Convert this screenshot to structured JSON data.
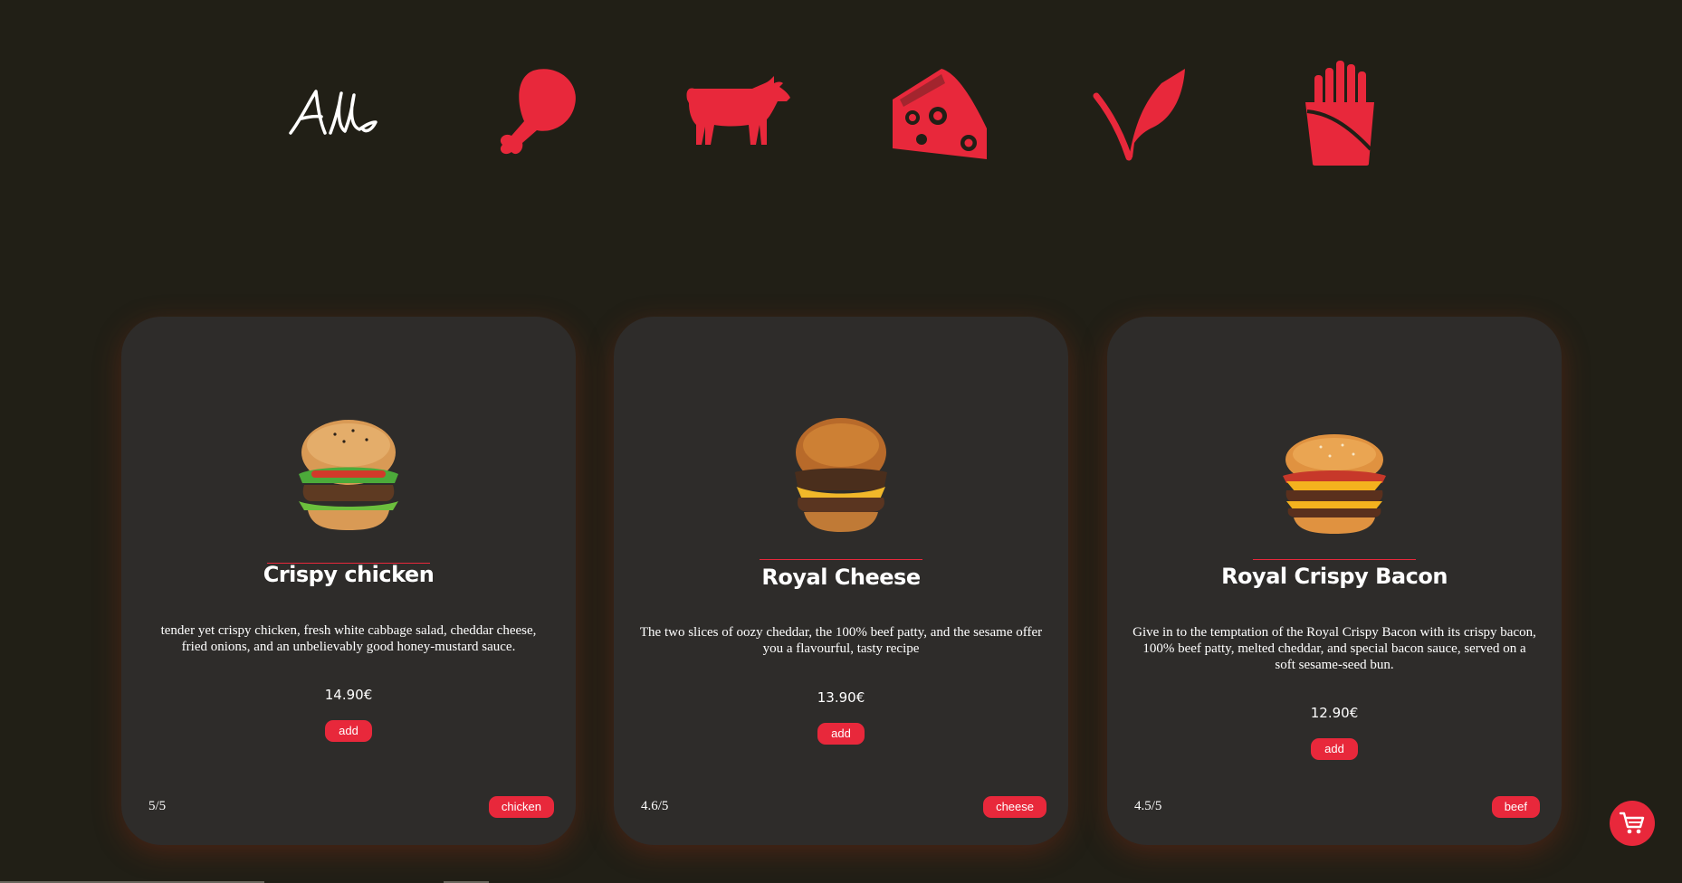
{
  "categories": [
    {
      "label": "All",
      "icon": "all-script-icon"
    },
    {
      "label": "chicken",
      "icon": "chicken-leg-icon"
    },
    {
      "label": "beef",
      "icon": "cow-icon"
    },
    {
      "label": "cheese",
      "icon": "cheese-icon"
    },
    {
      "label": "vegetarian",
      "icon": "leaf-icon"
    },
    {
      "label": "fries",
      "icon": "fries-icon"
    }
  ],
  "accent_color": "#e8283b",
  "background_color": "#211f16",
  "card_color": "#2e2c2a",
  "cards": [
    {
      "title": "Crispy chicken",
      "description": "tender yet crispy chicken, fresh white cabbage salad, cheddar cheese, fried onions, and an unbelievably good honey-mustard sauce.",
      "price": "14.90€",
      "add_label": "add",
      "rating": "5/5",
      "tag": "chicken"
    },
    {
      "title": "Royal Cheese",
      "description": "The two slices of oozy cheddar, the 100% beef patty, and the sesame offer you a flavourful, tasty recipe",
      "price": "13.90€",
      "add_label": "add",
      "rating": "4.6/5",
      "tag": "cheese"
    },
    {
      "title": "Royal Crispy Bacon",
      "description": "Give in to the temptation of the Royal Crispy Bacon with its crispy bacon, 100% beef patty, melted cheddar, and special bacon sauce, served on a soft sesame-seed bun.",
      "price": "12.90€",
      "add_label": "add",
      "rating": "4.5/5",
      "tag": "beef"
    }
  ],
  "cart": {
    "icon": "shopping-cart-icon"
  }
}
